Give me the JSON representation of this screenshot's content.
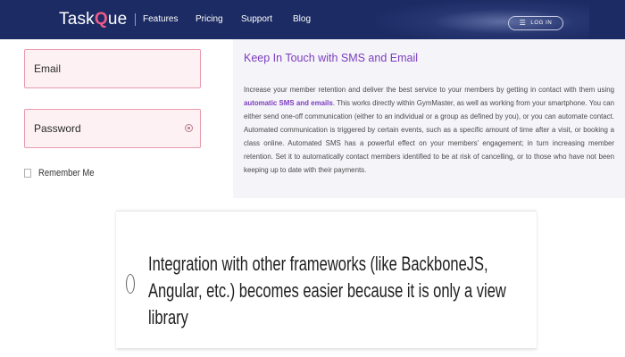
{
  "nav": {
    "logo_prefix": "Task",
    "logo_accent": "Q",
    "logo_suffix": "ue",
    "links": [
      "Features",
      "Pricing",
      "Support",
      "Blog"
    ],
    "login_label": "LOG IN",
    "background_color": "#1c2b63"
  },
  "form": {
    "email_label": "Email",
    "password_label": "Password",
    "remember_label": "Remember Me",
    "field_fill_color": "#fdf1f4",
    "field_border_color": "#e89aae"
  },
  "sms_panel": {
    "title": "Keep In Touch with SMS and Email",
    "body_before": "Increase your member retention and deliver the best service to your members by getting in contact with them using ",
    "body_highlight": "automatic SMS and emails",
    "body_after": ". This works directly within GymMaster, as well as working from your smartphone. You can either send one-off communication (either to an individual or a group as defined by you), or you can automate contact. Automated communication is triggered by certain events, such as a specific amount of time after a visit, or booking a class online. Automated SMS has a powerful effect on your members' engagement; in turn increasing member retention. Set it to automatically contact members identified to be at risk of cancelling, or to those who have not been keeping up to date with their payments.",
    "accent_color": "#7b3cbf"
  },
  "quiz_option": {
    "text": "Integration with other frameworks (like BackboneJS, Angular, etc.) becomes easier because it is only a view library"
  }
}
